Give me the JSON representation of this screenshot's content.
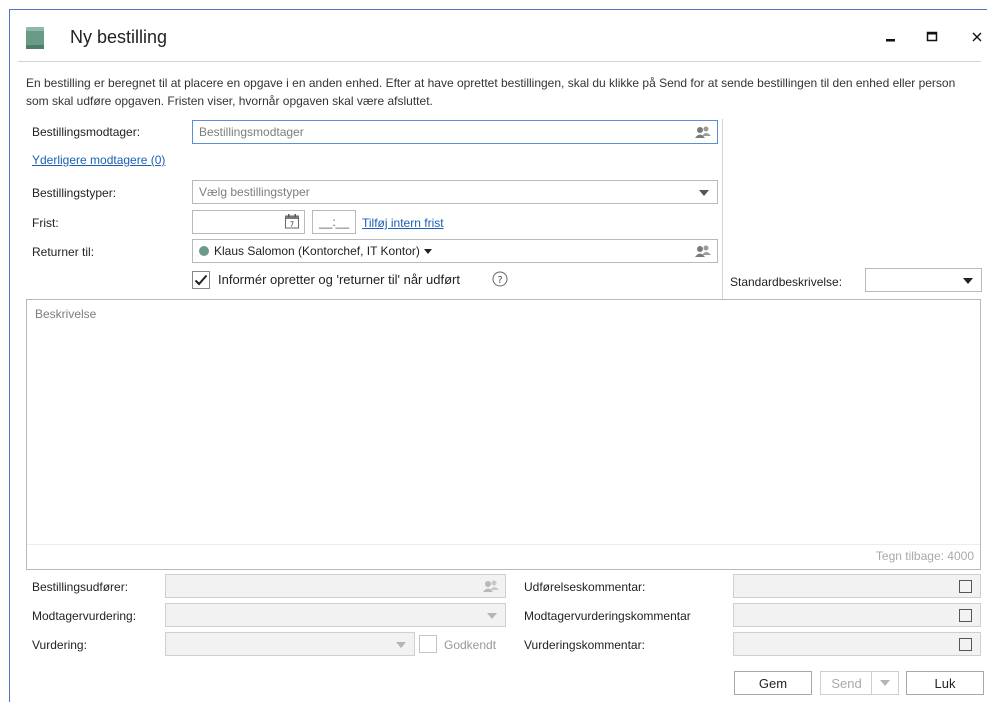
{
  "window": {
    "title": "Ny bestilling",
    "minimize_icon": "minimize-icon",
    "maximize_icon": "maximize-icon",
    "close_icon": "close-icon"
  },
  "intro_text": "En bestilling er beregnet til at placere en opgave i en anden enhed. Efter at have oprettet bestillingen, skal du klikke på Send for at sende bestillingen til den enhed eller person som skal udføre opgaven. Fristen viser, hvornår opgaven skal være afsluttet.",
  "form": {
    "recipient_label": "Bestillingsmodtager:",
    "recipient_placeholder": "Bestillingsmodtager",
    "more_recipients_link": "Yderligere modtagere (0)",
    "order_types_label": "Bestillingstyper:",
    "order_types_placeholder": "Vælg bestillingstyper",
    "deadline_label": "Frist:",
    "deadline_date": "",
    "deadline_time": "__:__",
    "add_internal_deadline_link": "Tilføj intern frist",
    "return_to_label": "Returner til:",
    "return_to_value": "Klaus Salomon (Kontorchef, IT Kontor)",
    "notify_checkbox_label": "Informér opretter og 'returner til' når udført",
    "notify_checked": true,
    "standard_desc_label": "Standardbeskrivelse:",
    "standard_desc_value": ""
  },
  "description": {
    "placeholder": "Beskrivelse",
    "counter": "Tegn tilbage: 4000"
  },
  "bottom": {
    "executor_label": "Bestillingsudfører:",
    "recipient_rating_label": "Modtagervurdering:",
    "rating_label": "Vurdering:",
    "approved_label": "Godkendt",
    "execution_comment_label": "Udførelseskommentar:",
    "recipient_rating_comment_label": "Modtagervurderingskommentar",
    "rating_comment_label": "Vurderingskommentar:"
  },
  "buttons": {
    "save": "Gem",
    "send": "Send",
    "close": "Luk"
  },
  "colors": {
    "accent_link": "#1a5fb4",
    "window_border": "#4a76c8",
    "app_icon": "#6a9b86",
    "status_dot": "#6a9b86"
  }
}
